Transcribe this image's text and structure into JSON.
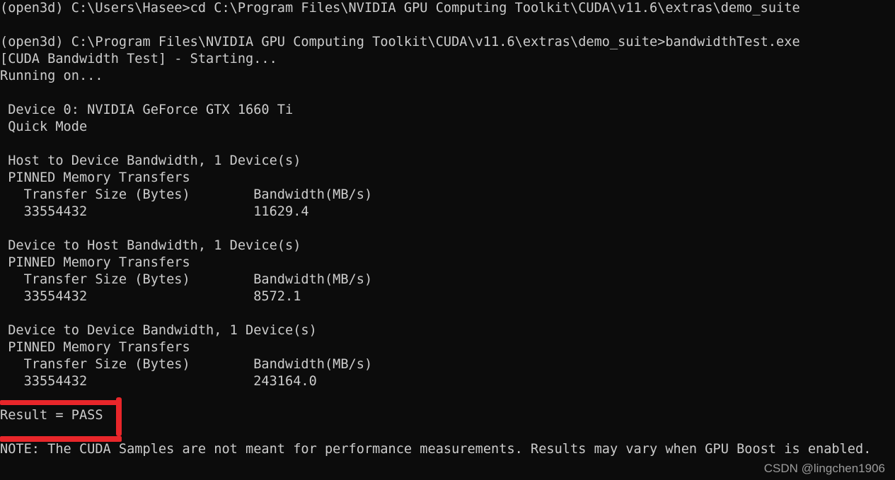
{
  "terminal": {
    "title": "Windows Command Prompt - CUDA Bandwidth Test",
    "background_color": "#0c0c0c",
    "text_color": "#cccccc",
    "prompt_env": "(open3d)",
    "commands": [
      {
        "prompt": "(open3d) C:\\Users\\Hasee>",
        "command": "cd C:\\Program Files\\NVIDIA GPU Computing Toolkit\\CUDA\\v11.6\\extras\\demo_suite"
      },
      {
        "prompt": "(open3d) C:\\Program Files\\NVIDIA GPU Computing Toolkit\\CUDA\\v11.6\\extras\\demo_suite>",
        "command": "bandwidthTest.exe"
      }
    ],
    "program_header": "[CUDA Bandwidth Test] - Starting...",
    "running_on_label": "Running on...",
    "device_line": " Device 0: NVIDIA GeForce GTX 1660 Ti",
    "mode_line": " Quick Mode",
    "sections": [
      {
        "heading": " Host to Device Bandwidth, 1 Device(s)",
        "transfer_type": " PINNED Memory Transfers",
        "col_size_header": "   Transfer Size (Bytes)",
        "col_bw_header": "Bandwidth(MB/s)",
        "transfer_size": "   33554432",
        "bandwidth": "11629.4"
      },
      {
        "heading": " Device to Host Bandwidth, 1 Device(s)",
        "transfer_type": " PINNED Memory Transfers",
        "col_size_header": "   Transfer Size (Bytes)",
        "col_bw_header": "Bandwidth(MB/s)",
        "transfer_size": "   33554432",
        "bandwidth": "8572.1"
      },
      {
        "heading": " Device to Device Bandwidth, 1 Device(s)",
        "transfer_type": " PINNED Memory Transfers",
        "col_size_header": "   Transfer Size (Bytes)",
        "col_bw_header": "Bandwidth(MB/s)",
        "transfer_size": "   33554432",
        "bandwidth": "243164.0"
      }
    ],
    "result_line": "Result = PASS",
    "note_line": "NOTE: The CUDA Samples are not meant for performance measurements. Results may vary when GPU Boost is enabled.",
    "full_text": "(open3d) C:\\Users\\Hasee>cd C:\\Program Files\\NVIDIA GPU Computing Toolkit\\CUDA\\v11.6\\extras\\demo_suite\n\n(open3d) C:\\Program Files\\NVIDIA GPU Computing Toolkit\\CUDA\\v11.6\\extras\\demo_suite>bandwidthTest.exe\n[CUDA Bandwidth Test] - Starting...\nRunning on...\n\n Device 0: NVIDIA GeForce GTX 1660 Ti\n Quick Mode\n\n Host to Device Bandwidth, 1 Device(s)\n PINNED Memory Transfers\n   Transfer Size (Bytes)        Bandwidth(MB/s)\n   33554432                     11629.4\n\n Device to Host Bandwidth, 1 Device(s)\n PINNED Memory Transfers\n   Transfer Size (Bytes)        Bandwidth(MB/s)\n   33554432                     8572.1\n\n Device to Device Bandwidth, 1 Device(s)\n PINNED Memory Transfers\n   Transfer Size (Bytes)        Bandwidth(MB/s)\n   33554432                     243164.0\n\nResult = PASS\n\nNOTE: The CUDA Samples are not meant for performance measurements. Results may vary when GPU Boost is enabled."
  },
  "annotation": {
    "color": "#e8262a",
    "target_text": "Result = PASS",
    "shape": "hand-drawn-bracket-box"
  },
  "watermark": {
    "text": "CSDN @lingchen1906",
    "color": "#9b9b9b"
  }
}
